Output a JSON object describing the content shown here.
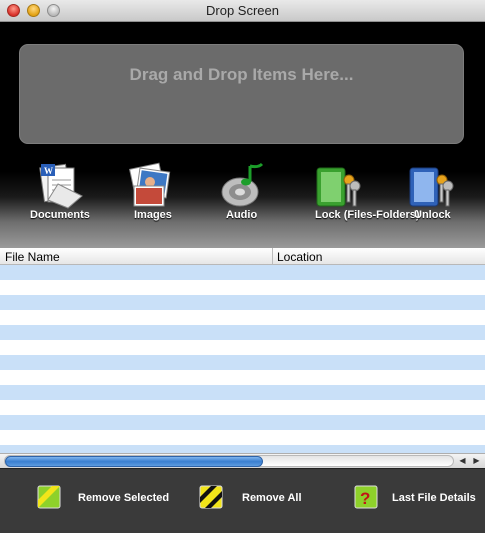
{
  "window": {
    "title": "Drop Screen"
  },
  "dropzone": {
    "text": "Drag and Drop Items Here..."
  },
  "toolbar": {
    "documents": "Documents",
    "images": "Images",
    "audio": "Audio",
    "lock": "Lock (Files-Folders)",
    "unlock": "Unlock"
  },
  "list": {
    "columns": [
      "File Name",
      "Location"
    ],
    "rows": []
  },
  "bottom": {
    "remove_selected": "Remove Selected",
    "remove_all": "Remove All",
    "last_file_details": "Last File Details"
  },
  "colors": {
    "row_stripe": "#c9e0f8",
    "accent": "#3a7fd0"
  }
}
